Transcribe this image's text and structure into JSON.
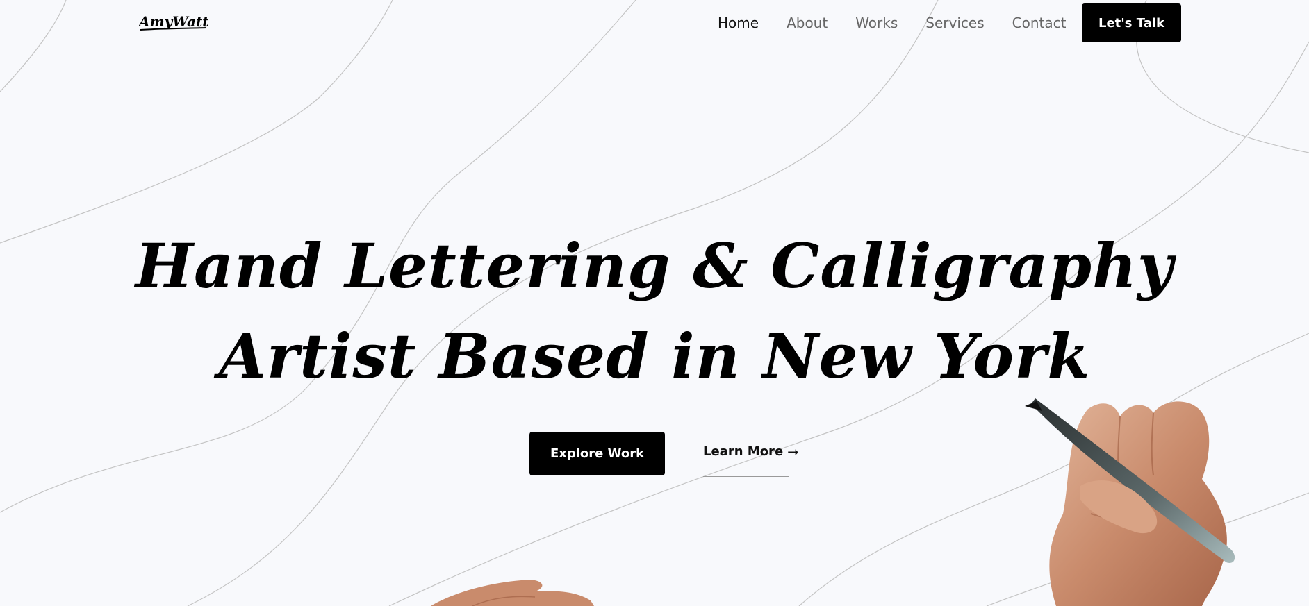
{
  "header": {
    "logo_text": "AmyWatt",
    "nav": [
      {
        "label": "Home",
        "active": true
      },
      {
        "label": "About",
        "active": false
      },
      {
        "label": "Works",
        "active": false
      },
      {
        "label": "Services",
        "active": false
      },
      {
        "label": "Contact",
        "active": false
      }
    ],
    "cta_label": "Let's Talk"
  },
  "hero": {
    "headline_line1": "Hand Lettering & Calligraphy",
    "headline_line2": "Artist Based in New York",
    "primary_button": "Explore Work",
    "secondary_link": "Learn More",
    "secondary_icon": "arrow-right-icon"
  },
  "colors": {
    "background": "#f8f9fc",
    "text": "#000000",
    "button_bg": "#000000",
    "button_text": "#ffffff",
    "nav_inactive": "#666666",
    "lines": "#bdbdbd"
  }
}
